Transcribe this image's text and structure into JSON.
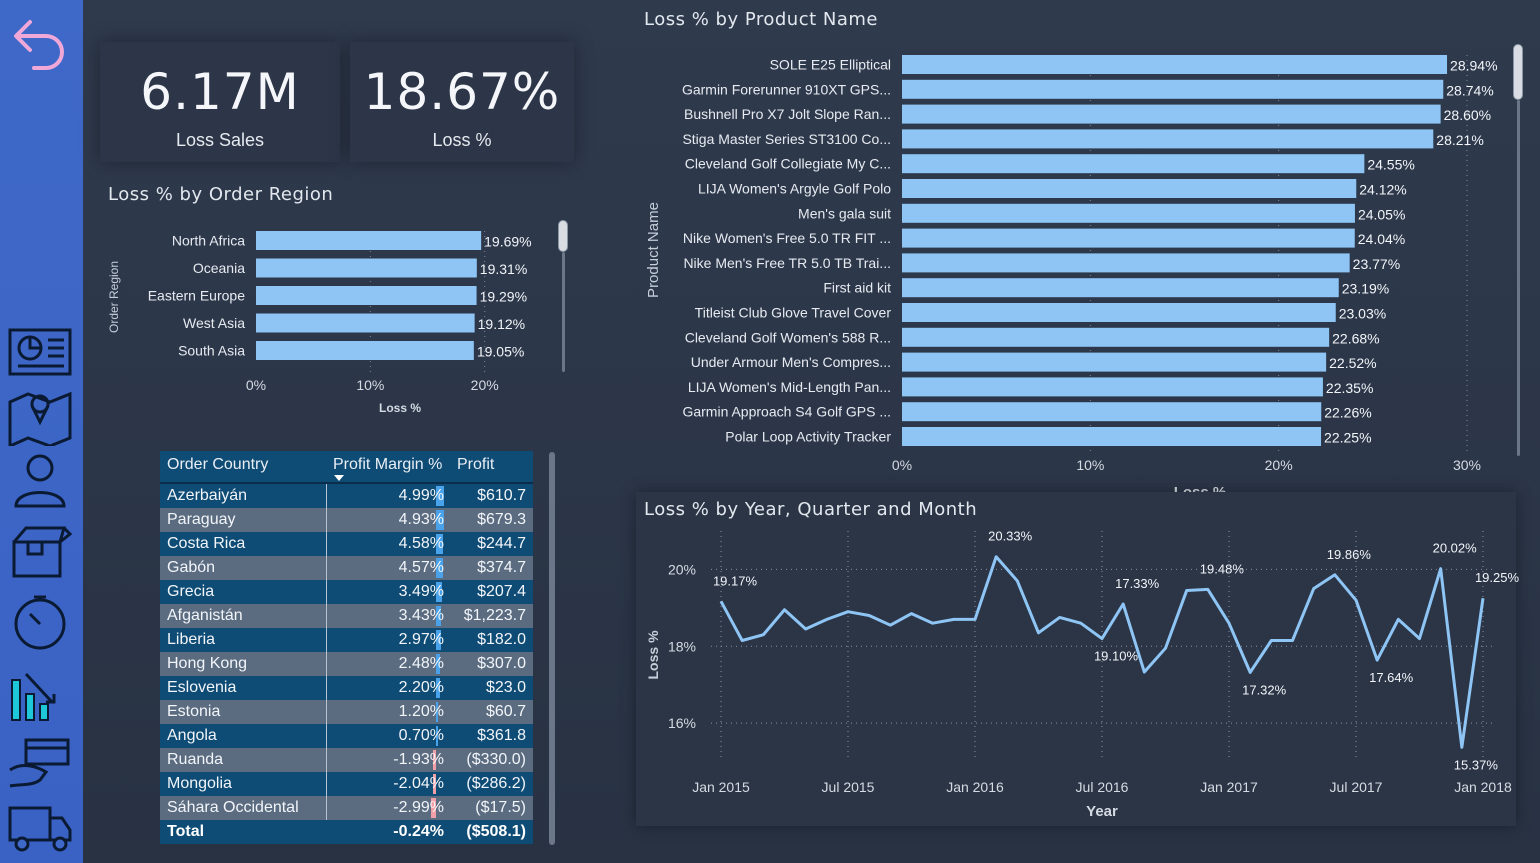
{
  "kpis": [
    {
      "value": "6.17M",
      "label": "Loss Sales"
    },
    {
      "value": "18.67%",
      "label": "Loss %"
    }
  ],
  "region_chart": {
    "title": "Loss % by Order Region",
    "ylabel": "Order Region",
    "xlabel": "Loss %",
    "ticks": [
      "0%",
      "10%",
      "20%"
    ]
  },
  "product_chart": {
    "title": "Loss % by Product Name",
    "ylabel": "Product Name",
    "xlabel": "Loss %",
    "ticks": [
      "0%",
      "10%",
      "20%",
      "30%"
    ]
  },
  "line_chart": {
    "title": "Loss % by Year, Quarter and Month",
    "ylabel": "Loss %",
    "xlabel": "Year",
    "yticks": [
      "20%",
      "18%",
      "16%"
    ],
    "xticks": [
      "Jan 2015",
      "Jul 2015",
      "Jan 2016",
      "Jul 2016",
      "Jan 2017",
      "Jul 2017",
      "Jan 2018"
    ]
  },
  "table": {
    "headers": [
      "Order Country",
      "Profit Margin %",
      "Profit"
    ],
    "rows": [
      {
        "country": "Azerbaiyán",
        "margin": "4.99%",
        "margin_value": 4.99,
        "profit": "$610.7"
      },
      {
        "country": "Paraguay",
        "margin": "4.93%",
        "margin_value": 4.93,
        "profit": "$679.3"
      },
      {
        "country": "Costa Rica",
        "margin": "4.58%",
        "margin_value": 4.58,
        "profit": "$244.7"
      },
      {
        "country": "Gabón",
        "margin": "4.57%",
        "margin_value": 4.57,
        "profit": "$374.7"
      },
      {
        "country": "Grecia",
        "margin": "3.49%",
        "margin_value": 3.49,
        "profit": "$207.4"
      },
      {
        "country": "Afganistán",
        "margin": "3.43%",
        "margin_value": 3.43,
        "profit": "$1,223.7"
      },
      {
        "country": "Liberia",
        "margin": "2.97%",
        "margin_value": 2.97,
        "profit": "$182.0"
      },
      {
        "country": "Hong Kong",
        "margin": "2.48%",
        "margin_value": 2.48,
        "profit": "$307.0"
      },
      {
        "country": "Eslovenia",
        "margin": "2.20%",
        "margin_value": 2.2,
        "profit": "$23.0"
      },
      {
        "country": "Estonia",
        "margin": "1.20%",
        "margin_value": 1.2,
        "profit": "$60.7"
      },
      {
        "country": "Angola",
        "margin": "0.70%",
        "margin_value": 0.7,
        "profit": "$361.8"
      },
      {
        "country": "Ruanda",
        "margin": "-1.93%",
        "margin_value": -1.93,
        "profit": "($330.0)"
      },
      {
        "country": "Mongolia",
        "margin": "-2.04%",
        "margin_value": -2.04,
        "profit": "($286.2)"
      },
      {
        "country": "Sáhara Occidental",
        "margin": "-2.99%",
        "margin_value": -2.99,
        "profit": "($17.5)"
      }
    ],
    "total": {
      "label": "Total",
      "margin": "-0.24%",
      "profit": "($508.1)"
    }
  },
  "colors": {
    "bar": "#8ec5f5",
    "positive_bar": "#4aa3ea",
    "negative_bar": "#f2a0a8",
    "sidebar": "#3f69c9",
    "back_arrow": "#f0a8d8"
  },
  "nav_icons": [
    "back-arrow-icon",
    "dashboard-icon",
    "map-icon",
    "customer-icon",
    "package-icon",
    "stopwatch-icon",
    "analytics-icon",
    "payment-icon",
    "delivery-truck-icon"
  ],
  "chart_data": [
    {
      "type": "bar",
      "title": "Loss % by Order Region",
      "xlabel": "Loss %",
      "ylabel": "Order Region",
      "orientation": "horizontal",
      "categories": [
        "North Africa",
        "Oceania",
        "Eastern Europe",
        "West Asia",
        "South Asia"
      ],
      "values": [
        19.69,
        19.31,
        19.29,
        19.12,
        19.05
      ],
      "labels": [
        "19.69%",
        "19.31%",
        "19.29%",
        "19.12%",
        "19.05%"
      ],
      "xlim": [
        0,
        23
      ]
    },
    {
      "type": "bar",
      "title": "Loss % by Product Name",
      "xlabel": "Loss %",
      "ylabel": "Product Name",
      "orientation": "horizontal",
      "categories": [
        "SOLE E25 Elliptical",
        "Garmin Forerunner 910XT GPS...",
        "Bushnell Pro X7 Jolt Slope Ran...",
        "Stiga Master Series ST3100 Co...",
        "Cleveland Golf Collegiate My C...",
        "LIJA Women's Argyle Golf Polo",
        "Men's gala suit",
        "Nike Women's Free 5.0 TR FIT ...",
        "Nike Men's Free TR 5.0 TB Trai...",
        "First aid kit",
        "Titleist Club Glove Travel Cover",
        "Cleveland Golf Women's 588 R...",
        "Under Armour Men's Compres...",
        "LIJA Women's Mid-Length Pan...",
        "Garmin Approach S4 Golf GPS ...",
        "Polar Loop Activity Tracker"
      ],
      "values": [
        28.94,
        28.74,
        28.6,
        28.21,
        24.55,
        24.12,
        24.05,
        24.04,
        23.77,
        23.19,
        23.03,
        22.68,
        22.52,
        22.35,
        22.26,
        22.25
      ],
      "labels": [
        "28.94%",
        "28.74%",
        "28.60%",
        "28.21%",
        "24.55%",
        "24.12%",
        "24.05%",
        "24.04%",
        "23.77%",
        "23.19%",
        "23.03%",
        "22.68%",
        "22.52%",
        "22.35%",
        "22.26%",
        "22.25%"
      ],
      "xlim": [
        0,
        30
      ]
    },
    {
      "type": "line",
      "title": "Loss % by Year, Quarter and Month",
      "xlabel": "Year",
      "ylabel": "Loss %",
      "x_start": "Jan 2015",
      "x_end": "Jan 2018",
      "values": [
        19.17,
        18.15,
        18.3,
        18.95,
        18.45,
        18.7,
        18.9,
        18.8,
        18.55,
        18.85,
        18.6,
        18.7,
        18.7,
        20.33,
        19.7,
        18.35,
        18.75,
        18.6,
        18.2,
        19.1,
        17.33,
        17.95,
        19.45,
        19.48,
        18.6,
        17.32,
        18.15,
        18.15,
        19.5,
        19.86,
        19.2,
        17.64,
        18.7,
        18.2,
        20.02,
        15.37,
        19.25
      ],
      "annotations": [
        {
          "x": "Jan 2015",
          "label": "19.17%"
        },
        {
          "x": "Feb 2016",
          "label": "20.33%"
        },
        {
          "x": "Jul 2016",
          "label": "19.10%"
        },
        {
          "x": "Aug 2016",
          "label": "17.33%"
        },
        {
          "x": "Dec 2016",
          "label": "19.48%"
        },
        {
          "x": "Feb 2017",
          "label": "17.32%"
        },
        {
          "x": "Jun 2017",
          "label": "19.86%"
        },
        {
          "x": "Aug 2017",
          "label": "17.64%"
        },
        {
          "x": "Nov 2017",
          "label": "20.02%"
        },
        {
          "x": "Dec 2017",
          "label": "15.37%"
        },
        {
          "x": "Jan 2018",
          "label": "19.25%"
        }
      ],
      "ylim": [
        15.3,
        21
      ]
    }
  ]
}
